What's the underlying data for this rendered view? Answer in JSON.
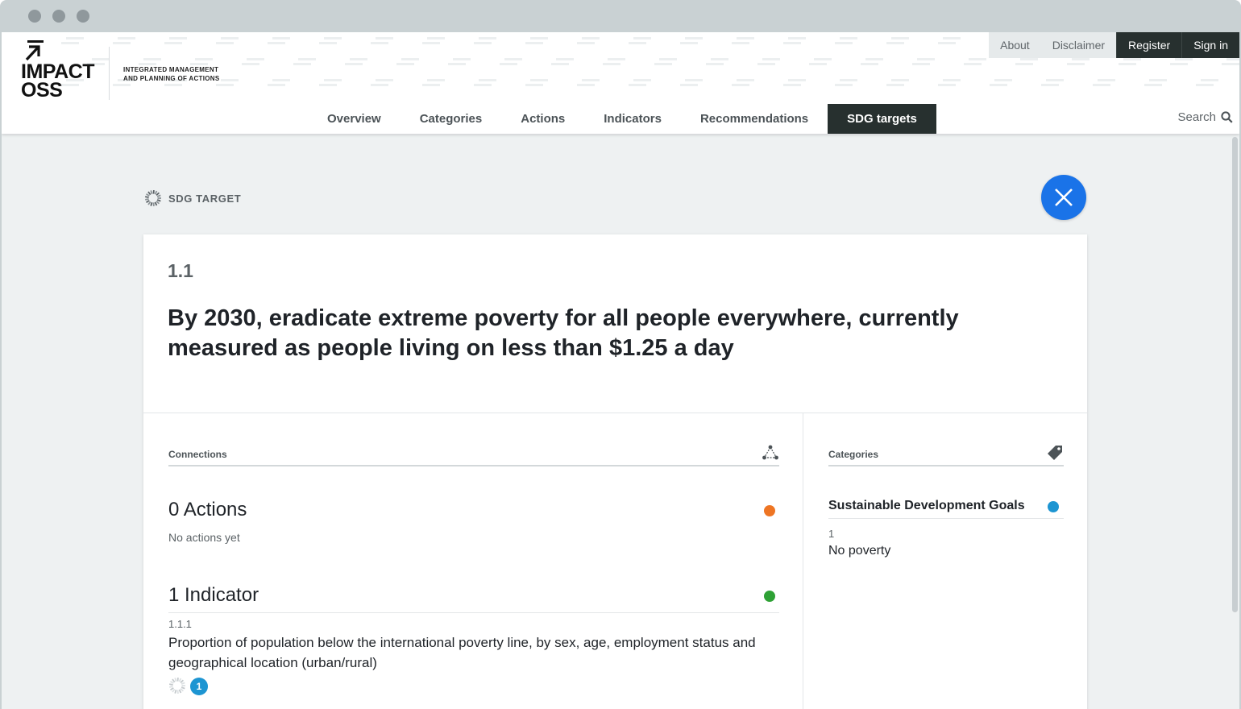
{
  "header": {
    "logo_text": "IMPACT OSS",
    "logo_line1": "IMPACT",
    "logo_line2": "OSS",
    "tagline_line1": "INTEGRATED MANAGEMENT",
    "tagline_line2": "AND PLANNING OF ACTIONS"
  },
  "topnav": {
    "about": "About",
    "disclaimer": "Disclaimer",
    "register": "Register",
    "signin": "Sign in"
  },
  "mainnav": {
    "items": [
      "Overview",
      "Categories",
      "Actions",
      "Indicators",
      "Recommendations",
      "SDG targets"
    ],
    "active": "SDG targets"
  },
  "search": {
    "label": "Search"
  },
  "page": {
    "type_label": "SDG TARGET",
    "target_code": "1.1",
    "target_title": "By 2030, eradicate extreme poverty for all people everywhere, currently measured as people living on less than $1.25 a day"
  },
  "connections": {
    "heading": "Connections",
    "actions": {
      "title": "0 Actions",
      "empty": "No actions yet",
      "color": "#ee7523"
    },
    "indicators": {
      "title": "1 Indicator",
      "color": "#2ea135",
      "items": [
        {
          "code": "1.1.1",
          "text": "Proportion of population below the international poverty line, by sex, age, employment status and geographical location (urban/rural)",
          "badge": "1"
        }
      ]
    }
  },
  "categories": {
    "heading": "Categories",
    "group": {
      "name": "Sustainable Development Goals",
      "color": "#1d95d2"
    },
    "item": {
      "code": "1",
      "label": "No poverty"
    }
  },
  "colors": {
    "accent": "#1a73e8",
    "nav_active": "#27302f",
    "background": "#eef1f2"
  }
}
